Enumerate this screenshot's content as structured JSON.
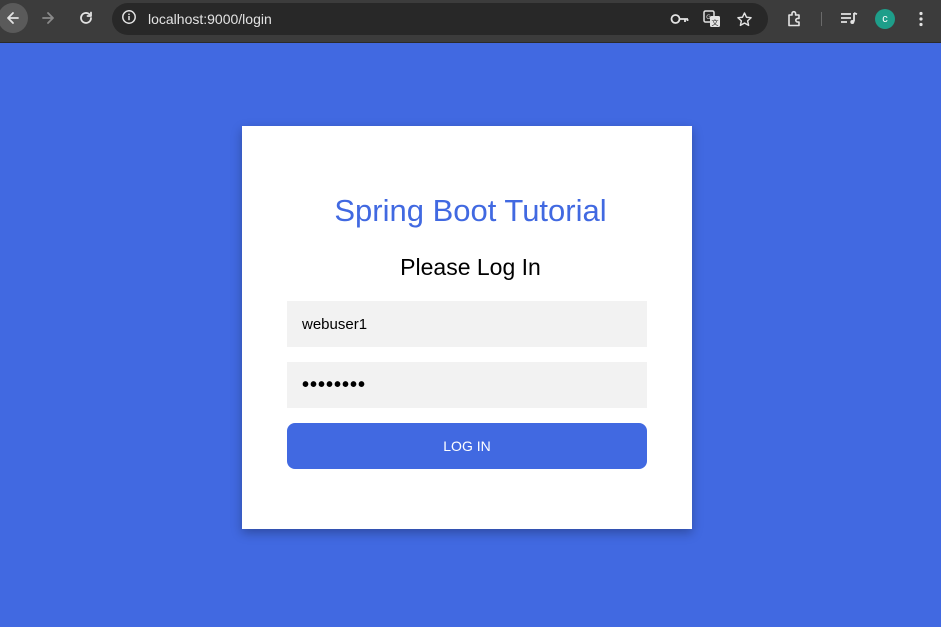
{
  "browser": {
    "url": "localhost:9000/login",
    "avatar_initial": "c",
    "icons": [
      "arrow-left-icon",
      "arrow-right-icon",
      "reload-icon",
      "info-icon",
      "key-icon",
      "translate-icon",
      "star-icon",
      "extensions-icon",
      "media-control-icon",
      "more-vert-icon"
    ]
  },
  "login": {
    "title": "Spring Boot Tutorial",
    "subtitle": "Please Log In",
    "username_value": "webuser1",
    "password_value": "••••••••",
    "button_label": "LOG IN"
  },
  "colors": {
    "background": "#4169e1",
    "accent": "#4169e1",
    "card": "#ffffff",
    "input_bg": "#f2f2f2",
    "chrome": "#3c3c3c"
  }
}
